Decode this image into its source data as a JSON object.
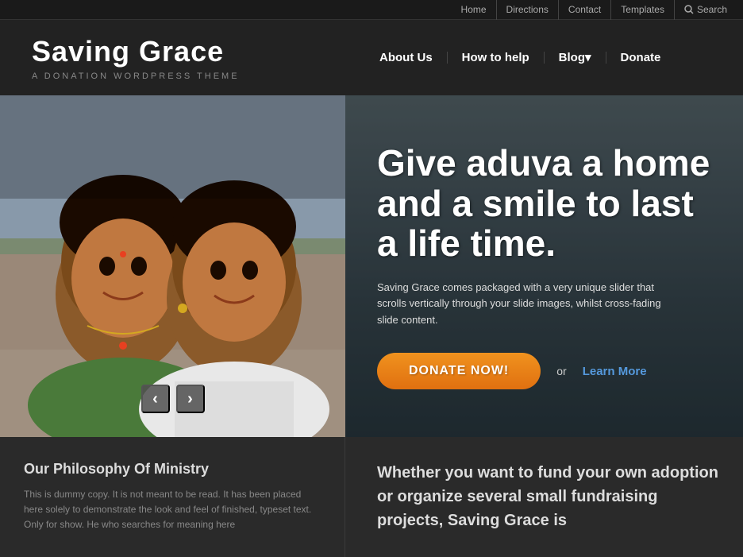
{
  "topNav": {
    "items": [
      {
        "label": "Home",
        "href": "#"
      },
      {
        "label": "Directions",
        "href": "#"
      },
      {
        "label": "Contact",
        "href": "#"
      },
      {
        "label": "Templates",
        "href": "#",
        "hasArrow": true
      },
      {
        "label": "Search",
        "href": "#",
        "hasIcon": true
      }
    ]
  },
  "header": {
    "logoTitle": "Saving Grace",
    "logoSubtitle": "A Donation WordPress Theme",
    "mainNav": [
      {
        "label": "About Us"
      },
      {
        "label": "How to help"
      },
      {
        "label": "Blog",
        "hasDropdown": true
      },
      {
        "label": "Donate"
      }
    ]
  },
  "hero": {
    "heading": "Give aduva a home and a smile to last a life time.",
    "description": "Saving Grace comes packaged with a very unique slider that scrolls vertically through your slide images, whilst cross-fading slide content.",
    "donateButton": "DONATE NOW!",
    "orText": "or",
    "learnMoreText": "Learn More"
  },
  "lower": {
    "leftHeading": "Our Philosophy Of Ministry",
    "leftText": "This is dummy copy. It is not meant to be read. It has been placed here solely to demonstrate the look and feel of finished, typeset text. Only for show. He who searches for meaning here",
    "rightText": "Whether you want to fund your own adoption or organize several small fundraising projects, Saving Grace is"
  },
  "icons": {
    "search": "🔍",
    "arrowLeft": "‹",
    "arrowRight": "›",
    "dropdown": "▾"
  }
}
